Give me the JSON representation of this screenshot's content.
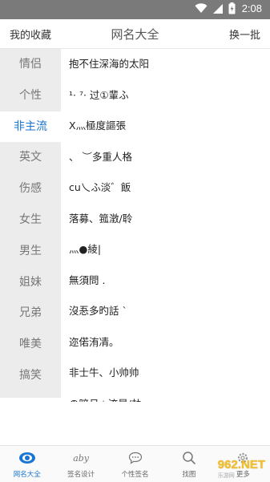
{
  "status_bar": {
    "time": "2:08"
  },
  "header": {
    "left_label": "我的收藏",
    "title": "网名大全",
    "right_label": "换一批"
  },
  "sidebar": {
    "items": [
      "情侣",
      "个性",
      "非主流",
      "英文",
      "伤感",
      "女生",
      "男生",
      "姐妹",
      "兄弟",
      "唯美",
      "搞笑"
    ],
    "active": "非主流"
  },
  "names": [
    "抱不住深海的太阳",
    "¹· ⁷· 过①輩ふ",
    "X灬極度謳張",
    "、 ︶多重人格",
    "cu乀ふ淡゛飯",
    "落募、箛澂/聆",
    "灬●綾|",
    "無須問 .",
    "沒忢多旳話 `",
    "迩偌洧凊。",
    "非士牛、小帅帅",
    "の暗月☆流星/劫"
  ],
  "bottom_nav": {
    "tabs": [
      {
        "label": "网名大全",
        "icon": "eye-icon"
      },
      {
        "label": "签名设计",
        "icon": "signature-icon",
        "glyph": "aby"
      },
      {
        "label": "个性签名",
        "icon": "speech-bubble-icon"
      },
      {
        "label": "找图",
        "icon": "search-icon"
      },
      {
        "label": "更多",
        "icon": "gear-icon"
      }
    ],
    "active": "网名大全"
  },
  "watermark": {
    "text": "962.NET",
    "subtext": "乐游网"
  },
  "colors": {
    "accent": "#1976d2",
    "status_bar": "#7a7a7a",
    "sidebar_bg": "#ececec"
  }
}
